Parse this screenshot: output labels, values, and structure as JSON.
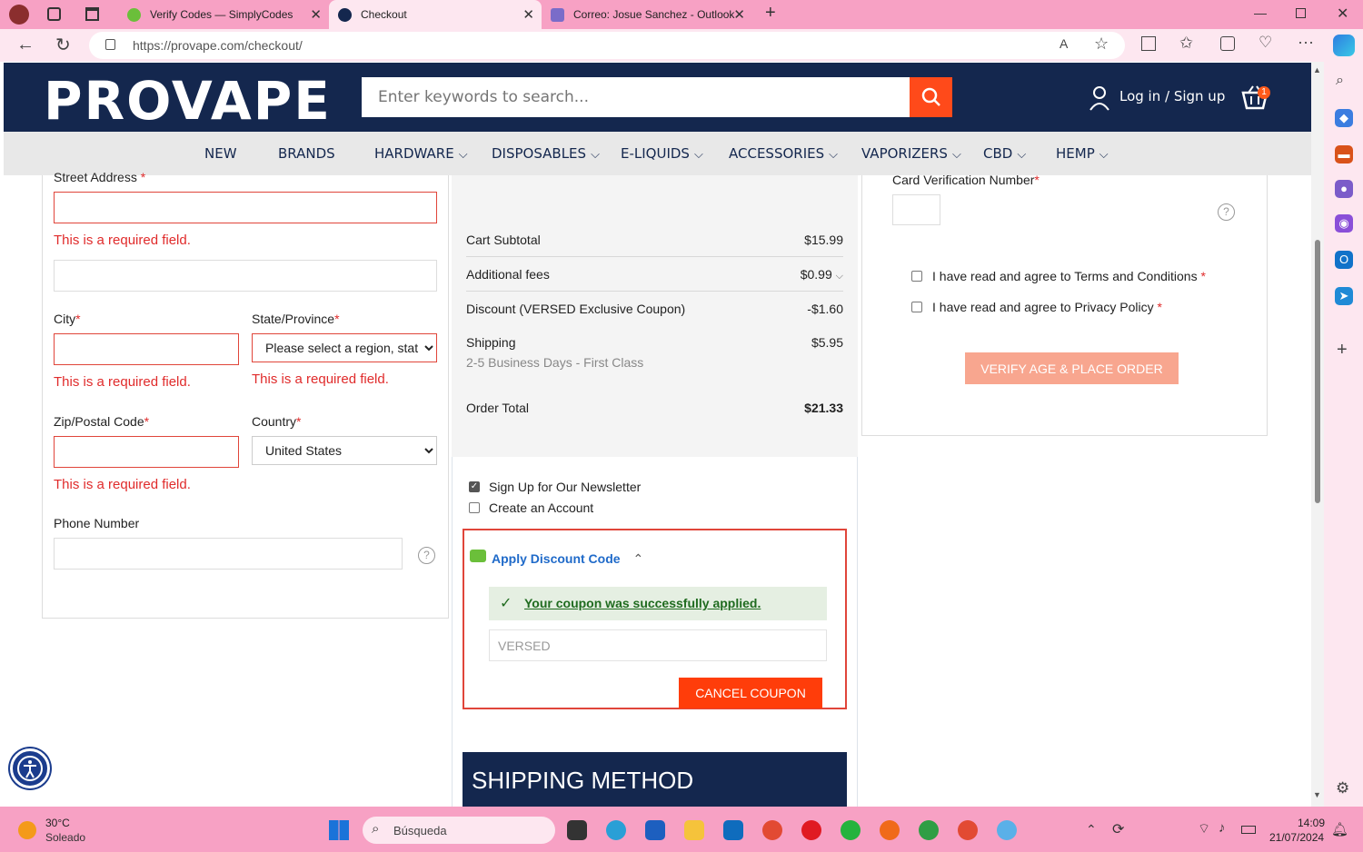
{
  "browser": {
    "tabs": [
      {
        "title": "Verify Codes — SimplyCodes",
        "active": false
      },
      {
        "title": "Checkout",
        "active": true
      },
      {
        "title": "Correo: Josue Sanchez - Outlook",
        "active": false
      }
    ],
    "url": "https://provape.com/checkout/"
  },
  "header": {
    "logo": "PROVAPE",
    "search_placeholder": "Enter keywords to search...",
    "login_label": "Log in / Sign up",
    "cart_count": "1"
  },
  "nav": {
    "items": [
      {
        "label": "NEW",
        "dropdown": false
      },
      {
        "label": "BRANDS",
        "dropdown": false
      },
      {
        "label": "HARDWARE",
        "dropdown": true
      },
      {
        "label": "DISPOSABLES",
        "dropdown": true
      },
      {
        "label": "E-LIQUIDS",
        "dropdown": true
      },
      {
        "label": "ACCESSORIES",
        "dropdown": true
      },
      {
        "label": "VAPORIZERS",
        "dropdown": true
      },
      {
        "label": "CBD",
        "dropdown": true
      },
      {
        "label": "HEMP",
        "dropdown": true
      }
    ]
  },
  "address_form": {
    "street_label": "Street Address",
    "required_error": "This is a required field.",
    "city_label": "City",
    "state_label": "State/Province",
    "state_value": "Please select a region, stat",
    "zip_label": "Zip/Postal Code",
    "country_label": "Country",
    "country_value": "United States",
    "phone_label": "Phone Number",
    "help_glyph": "?"
  },
  "summary": {
    "subtotal_label": "Cart Subtotal",
    "subtotal_value": "$15.99",
    "fees_label": "Additional fees",
    "fees_value": "$0.99",
    "discount_label": "Discount (VERSED Exclusive Coupon)",
    "discount_value": "-$1.60",
    "shipping_label": "Shipping",
    "shipping_value": "$5.95",
    "shipping_detail": "2-5 Business Days - First Class",
    "total_label": "Order Total",
    "total_value": "$21.33",
    "newsletter_label": "Sign Up for Our Newsletter",
    "newsletter_checked": true,
    "create_account_label": "Create an Account",
    "create_account_checked": false
  },
  "discount": {
    "title": "Apply Discount Code",
    "success_message": "Your coupon was successfully applied.",
    "code_value": "VERSED",
    "cancel_label": "CANCEL COUPON"
  },
  "shipping_method": {
    "title": "SHIPPING METHOD"
  },
  "payment": {
    "cvn_label": "Card Verification Number",
    "terms_label": "I have read and agree to Terms and Conditions",
    "privacy_label": "I have read and agree to Privacy Policy",
    "place_order_label": "VERIFY AGE & PLACE ORDER"
  },
  "taskbar": {
    "weather_temp": "30°C",
    "weather_desc": "Soleado",
    "search_label": "Búsqueda",
    "time": "14:09",
    "date": "21/07/2024"
  },
  "colors": {
    "brand_navy": "#14274e",
    "accent_orange": "#ff3d0a",
    "error_red": "#e02b2b",
    "success_green": "#1f6b1f"
  }
}
